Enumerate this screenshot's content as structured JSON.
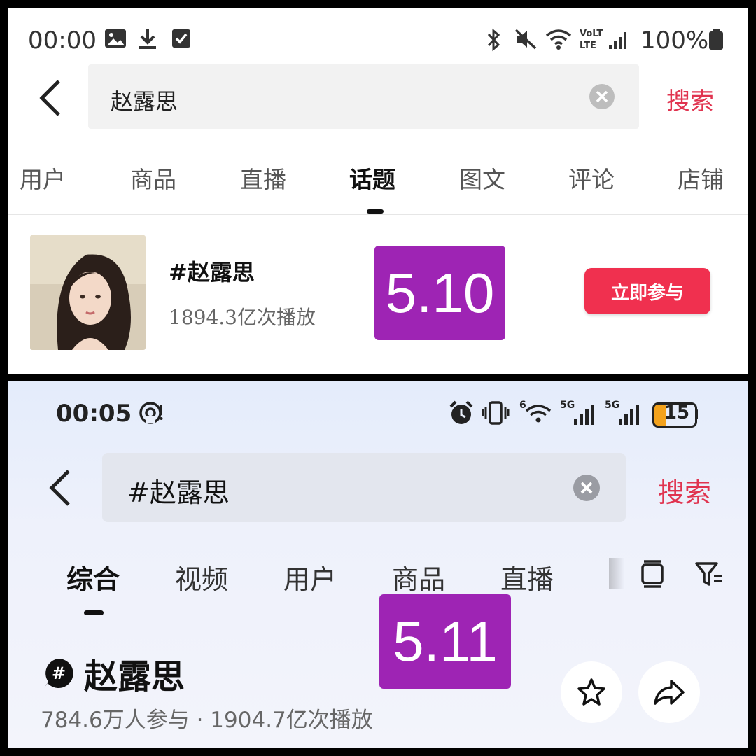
{
  "top": {
    "status": {
      "time": "00:00",
      "battery": "100%"
    },
    "search": {
      "query": "赵露思",
      "action": "搜索"
    },
    "tabs": [
      {
        "label": "用户"
      },
      {
        "label": "商品"
      },
      {
        "label": "直播"
      },
      {
        "label": "话题",
        "active": true
      },
      {
        "label": "图文"
      },
      {
        "label": "评论"
      },
      {
        "label": "店铺"
      }
    ],
    "topic": {
      "title": "#赵露思",
      "plays": "1894.3亿次播放",
      "join": "立即参与"
    },
    "date_badge": "5.10"
  },
  "bottom": {
    "status": {
      "time": "00:05",
      "net1": "5G",
      "net2": "5G",
      "battery": "15"
    },
    "search": {
      "query": "#赵露思",
      "action": "搜索"
    },
    "tabs": [
      {
        "label": "综合",
        "active": true
      },
      {
        "label": "视频"
      },
      {
        "label": "用户"
      },
      {
        "label": "商品"
      },
      {
        "label": "直播"
      }
    ],
    "topic": {
      "title": "赵露思",
      "stats": "784.6万人参与 · 1904.7亿次播放"
    },
    "date_badge": "5.11"
  },
  "colors": {
    "accent": "#e0334f",
    "join_button": "#f0304f",
    "badge": "#9e24b4"
  }
}
